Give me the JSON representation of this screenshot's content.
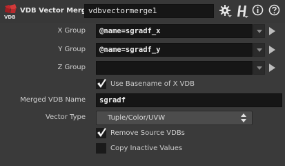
{
  "header": {
    "icon_text": "VDB",
    "node_type": "VDB Vector Merge",
    "node_name": "vdbvectormerge1",
    "icons": [
      "gear-icon",
      "help-h-icon",
      "info-icon",
      "question-icon"
    ]
  },
  "params": {
    "x_group": {
      "label": "X Group",
      "value": "@name=sgradf_x"
    },
    "y_group": {
      "label": "Y Group",
      "value": "@name=sgradf_y"
    },
    "z_group": {
      "label": "Z Group",
      "value": ""
    },
    "use_basename": {
      "label": "Use Basename of X VDB",
      "checked": true
    },
    "merged_name": {
      "label": "Merged VDB Name",
      "value": "sgradf"
    },
    "vector_type": {
      "label": "Vector Type",
      "value": "Tuple/Color/UVW"
    },
    "remove_source": {
      "label": "Remove Source VDBs",
      "checked": true
    },
    "copy_inactive": {
      "label": "Copy Inactive Values",
      "checked": false
    }
  },
  "colors": {
    "background": "#3a3a3a",
    "field": "#161616",
    "icon_red": "#c0282c"
  }
}
